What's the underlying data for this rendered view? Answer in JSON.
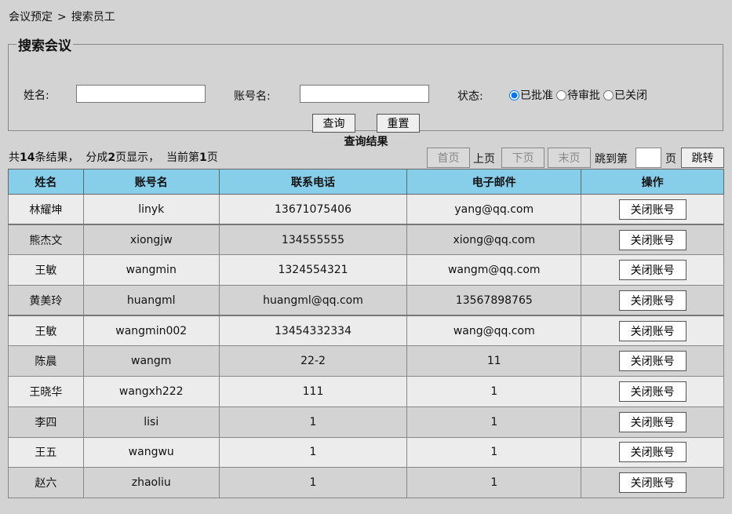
{
  "breadcrumb": {
    "parent": "会议预定",
    "separator": ">",
    "current": "搜索员工"
  },
  "search": {
    "legend": "搜索会议",
    "name_label": "姓名:",
    "name_value": "",
    "account_label": "账号名:",
    "account_value": "",
    "status_label": "状态:",
    "status_options": [
      "已批准",
      "待审批",
      "已关闭"
    ],
    "status_selected": "已批准",
    "query_button": "查询",
    "reset_button": "重置"
  },
  "results": {
    "title": "查询结果",
    "summary": {
      "prefix": "共",
      "total": "14",
      "mid1": "条结果，  分成",
      "pages": "2",
      "mid2": "页显示，  当前第",
      "current": "1",
      "suffix": "页"
    }
  },
  "pager": {
    "first": "首页",
    "prev": "上页",
    "next": "下页",
    "last": "末页",
    "jump_prefix": "跳到第",
    "jump_suffix": "页",
    "jump_value": "",
    "jump_button": "跳转"
  },
  "table": {
    "columns": [
      "姓名",
      "账号名",
      "联系电话",
      "电子邮件",
      "操作"
    ],
    "action_label": "关闭账号",
    "rows": [
      {
        "name": "林耀坤",
        "account": "linyk",
        "phone": "13671075406",
        "email": "yang@qq.com"
      },
      {
        "name": "熊杰文",
        "account": "xiongjw",
        "phone": "134555555",
        "email": "xiong@qq.com"
      },
      {
        "name": "王敏",
        "account": "wangmin",
        "phone": "1324554321",
        "email": "wangm@qq.com"
      },
      {
        "name": "黄美玲",
        "account": "huangml",
        "phone": "huangml@qq.com",
        "email": "13567898765"
      },
      {
        "name": "王敏",
        "account": "wangmin002",
        "phone": "13454332334",
        "email": "wang@qq.com"
      },
      {
        "name": "陈晨",
        "account": "wangm",
        "phone": "22-2",
        "email": "11"
      },
      {
        "name": "王晓华",
        "account": "wangxh222",
        "phone": "111",
        "email": "1"
      },
      {
        "name": "李四",
        "account": "lisi",
        "phone": "1",
        "email": "1"
      },
      {
        "name": "王五",
        "account": "wangwu",
        "phone": "1",
        "email": "1"
      },
      {
        "name": "赵六",
        "account": "zhaoliu",
        "phone": "1",
        "email": "1"
      }
    ]
  },
  "colors": {
    "header_bg": "#87ceeb",
    "page_bg": "#d3d3d3",
    "row_light": "#ececec"
  }
}
